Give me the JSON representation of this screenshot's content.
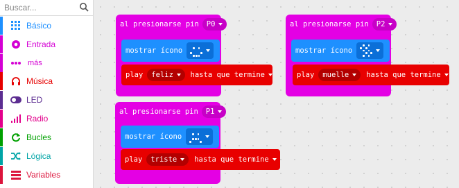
{
  "search": {
    "placeholder": "Buscar..."
  },
  "categories": [
    {
      "label": "Básico",
      "color": "#1e90ff",
      "icon": "grid-icon"
    },
    {
      "label": "Entrada",
      "color": "#d400d4",
      "icon": "target-icon"
    },
    {
      "label": "más",
      "color": "#d400d4",
      "icon": "more-dots-icon"
    },
    {
      "label": "Música",
      "color": "#e60000",
      "icon": "headphones-icon"
    },
    {
      "label": "LED",
      "color": "#5c2d91",
      "icon": "toggle-icon"
    },
    {
      "label": "Radio",
      "color": "#e3008c",
      "icon": "signal-bars-icon"
    },
    {
      "label": "Bucles",
      "color": "#00a000",
      "icon": "refresh-icon"
    },
    {
      "label": "Lógica",
      "color": "#00a4a6",
      "icon": "shuffle-icon"
    },
    {
      "label": "Variables",
      "color": "#dc143c",
      "icon": "list-icon"
    }
  ],
  "blocks": {
    "event_p0": {
      "head": "al presionarse pin",
      "pin": "P0",
      "show": "mostrar ícono",
      "play": "play",
      "melody": "feliz",
      "until": "hasta que termine"
    },
    "event_p2": {
      "head": "al presionarse pin",
      "pin": "P2",
      "show": "mostrar ícono",
      "play": "play",
      "melody": "muelle",
      "until": "hasta que termine"
    },
    "event_p1": {
      "head": "al presionarse pin",
      "pin": "P1",
      "show": "mostrar ícono",
      "play": "play",
      "melody": "triste",
      "until": "hasta que termine"
    }
  }
}
